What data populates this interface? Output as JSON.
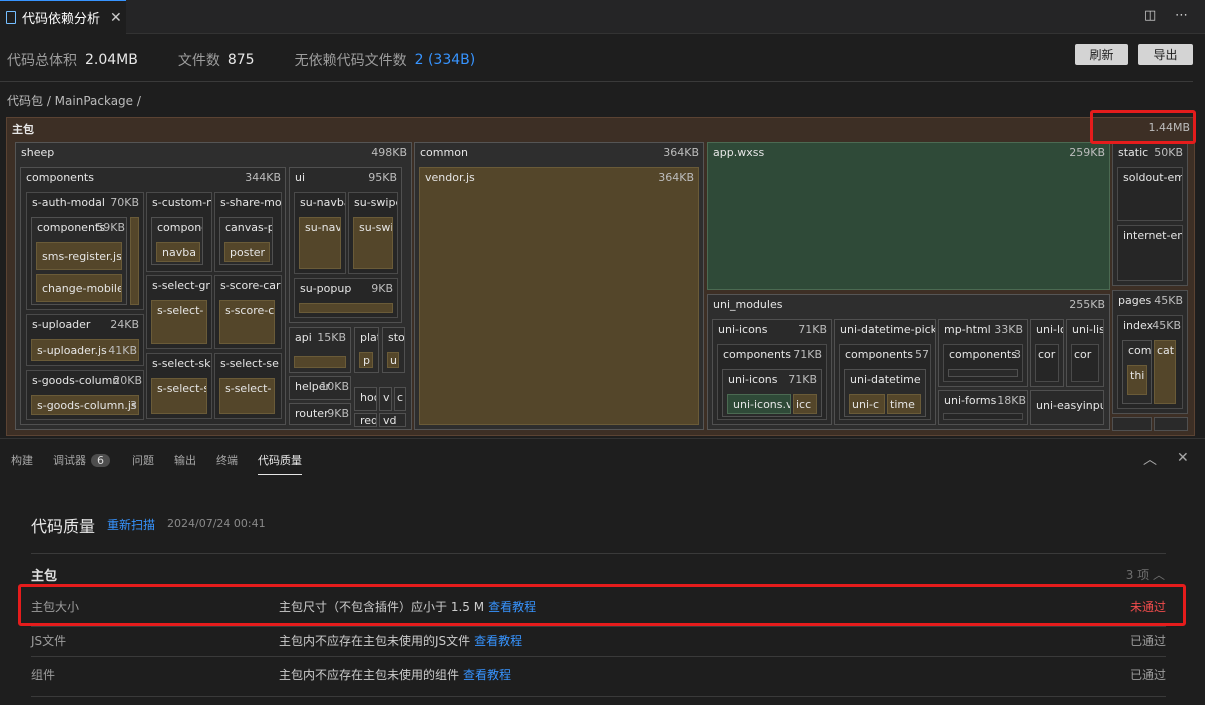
{
  "tab": {
    "title": "代码依赖分析",
    "close_glyph": "✕"
  },
  "titlebar": {
    "split_glyph": "◫",
    "more_glyph": "⋯"
  },
  "summary": {
    "total_label": "代码总体积",
    "total_value": "2.04MB",
    "files_label": "文件数",
    "files_value": "875",
    "unused_label": "无依赖代码文件数",
    "unused_value": "2 (334B)"
  },
  "buttons": {
    "refresh": "刷新",
    "export": "导出"
  },
  "breadcrumb": "代码包 / MainPackage /",
  "treemap": {
    "root": {
      "name": "主包",
      "size": "1.44MB"
    },
    "sheep": {
      "name": "sheep",
      "size": "498KB"
    },
    "components": {
      "name": "components",
      "size": "344KB"
    },
    "auth_modal": {
      "name": "s-auth-modal",
      "size": "70KB"
    },
    "auth_components": {
      "name": "components",
      "size": "59KB"
    },
    "sms_register": {
      "name": "sms-register.js"
    },
    "change_mobile": {
      "name": "change-mobile"
    },
    "custom_nav": {
      "name": "s-custom-n"
    },
    "custom_nav_comp": {
      "name": "compone"
    },
    "navbar_leaf": {
      "name": "navba"
    },
    "share_modal": {
      "name": "s-share-mo"
    },
    "canvas_poster": {
      "name": "canvas-p"
    },
    "poster_leaf": {
      "name": "poster"
    },
    "select_group": {
      "name": "s-select-gr"
    },
    "select_group_leaf": {
      "name": "s-select-"
    },
    "score_card": {
      "name": "s-score-car"
    },
    "score_card_leaf": {
      "name": "s-score-c"
    },
    "uploader": {
      "name": "s-uploader",
      "size": "24KB"
    },
    "uploader_js": {
      "name": "s-uploader.js",
      "size": "41KB"
    },
    "select_sku": {
      "name": "s-select-sku"
    },
    "select_sku_leaf": {
      "name": "s-select-s"
    },
    "select_seckill": {
      "name": "s-select-se"
    },
    "select_seckill_leaf": {
      "name": "s-select-"
    },
    "goods_column": {
      "name": "s-goods-column",
      "size": "20KB"
    },
    "goods_column_js": {
      "name": "s-goods-column.js",
      "size": "3"
    },
    "ui": {
      "name": "ui",
      "size": "95KB"
    },
    "su_navbar": {
      "name": "su-navba"
    },
    "su_navbar_leaf": {
      "name": "su-nav"
    },
    "su_swiper": {
      "name": "su-swipe"
    },
    "su_swiper_leaf": {
      "name": "su-swi"
    },
    "su_popup": {
      "name": "su-popup",
      "size": "9KB"
    },
    "api": {
      "name": "api",
      "size": "15KB"
    },
    "platform": {
      "name": "plat"
    },
    "platform_leaf": {
      "name": "p"
    },
    "store": {
      "name": "sto"
    },
    "store_leaf": {
      "name": "u"
    },
    "helper": {
      "name": "helper",
      "size": "10KB"
    },
    "hooks": {
      "name": "hoo"
    },
    "v_dir": {
      "name": "v"
    },
    "c_dir": {
      "name": "c"
    },
    "router": {
      "name": "router",
      "size": "9KB"
    },
    "req": {
      "name": "req"
    },
    "vd": {
      "name": "vd"
    },
    "common": {
      "name": "common",
      "size": "364KB"
    },
    "vendor": {
      "name": "vendor.js",
      "size": "364KB"
    },
    "app_wxss": {
      "name": "app.wxss",
      "size": "259KB"
    },
    "static": {
      "name": "static",
      "size": "50KB"
    },
    "soldout": {
      "name": "soldout-em"
    },
    "internet": {
      "name": "internet-em"
    },
    "pages": {
      "name": "pages",
      "size": "45KB"
    },
    "index": {
      "name": "index",
      "size": "45KB"
    },
    "comp": {
      "name": "comp"
    },
    "thi": {
      "name": "thi"
    },
    "cat": {
      "name": "cat"
    },
    "uni_modules": {
      "name": "uni_modules",
      "size": "255KB"
    },
    "uni_icons": {
      "name": "uni-icons",
      "size": "71KB"
    },
    "uni_icons_comp": {
      "name": "components",
      "size": "71KB"
    },
    "uni_icons_inner": {
      "name": "uni-icons",
      "size": "71KB"
    },
    "uni_icons_js": {
      "name": "uni-icons.v"
    },
    "icc": {
      "name": "icc"
    },
    "datetime": {
      "name": "uni-datetime-pick"
    },
    "datetime_comp": {
      "name": "components",
      "size": "57"
    },
    "datetime_inner": {
      "name": "uni-datetime"
    },
    "uni_c": {
      "name": "uni-c"
    },
    "time": {
      "name": "time"
    },
    "mp_html": {
      "name": "mp-html",
      "size": "33KB"
    },
    "mp_html_comp": {
      "name": "components",
      "size": "3"
    },
    "uni_lo": {
      "name": "uni-lo"
    },
    "cor1": {
      "name": "cor"
    },
    "uni_li": {
      "name": "uni-lis"
    },
    "cor2": {
      "name": "cor"
    },
    "uni_forms": {
      "name": "uni-forms",
      "size": "18KB"
    },
    "easyinput": {
      "name": "uni-easyinpu"
    }
  },
  "panel_tabs": [
    {
      "label": "构建"
    },
    {
      "label": "调试器",
      "badge": "6"
    },
    {
      "label": "问题"
    },
    {
      "label": "输出"
    },
    {
      "label": "终端"
    },
    {
      "label": "代码质量"
    }
  ],
  "panel_actions": {
    "collapse_glyph": "︿",
    "close_glyph": "✕"
  },
  "quality": {
    "title": "代码质量",
    "rescan": "重新扫描",
    "timestamp": "2024/07/24 00:41",
    "section": {
      "title": "主包",
      "count": "3 项 ︿"
    },
    "rows": [
      {
        "name": "主包大小",
        "desc": "主包尺寸（不包含插件）应小于 1.5 M",
        "link": "查看教程",
        "status": "未通过"
      },
      {
        "name": "JS文件",
        "desc": "主包内不应存在主包未使用的JS文件",
        "link": "查看教程",
        "status": "已通过"
      },
      {
        "name": "组件",
        "desc": "主包内不应存在主包未使用的组件",
        "link": "查看教程",
        "status": "已通过"
      }
    ]
  },
  "colors": {
    "accent": "#3794ff",
    "fail": "#f14c4c",
    "highlight": "#e51c1c",
    "leaf": "#54462a",
    "green_leaf": "#2f4a38"
  }
}
